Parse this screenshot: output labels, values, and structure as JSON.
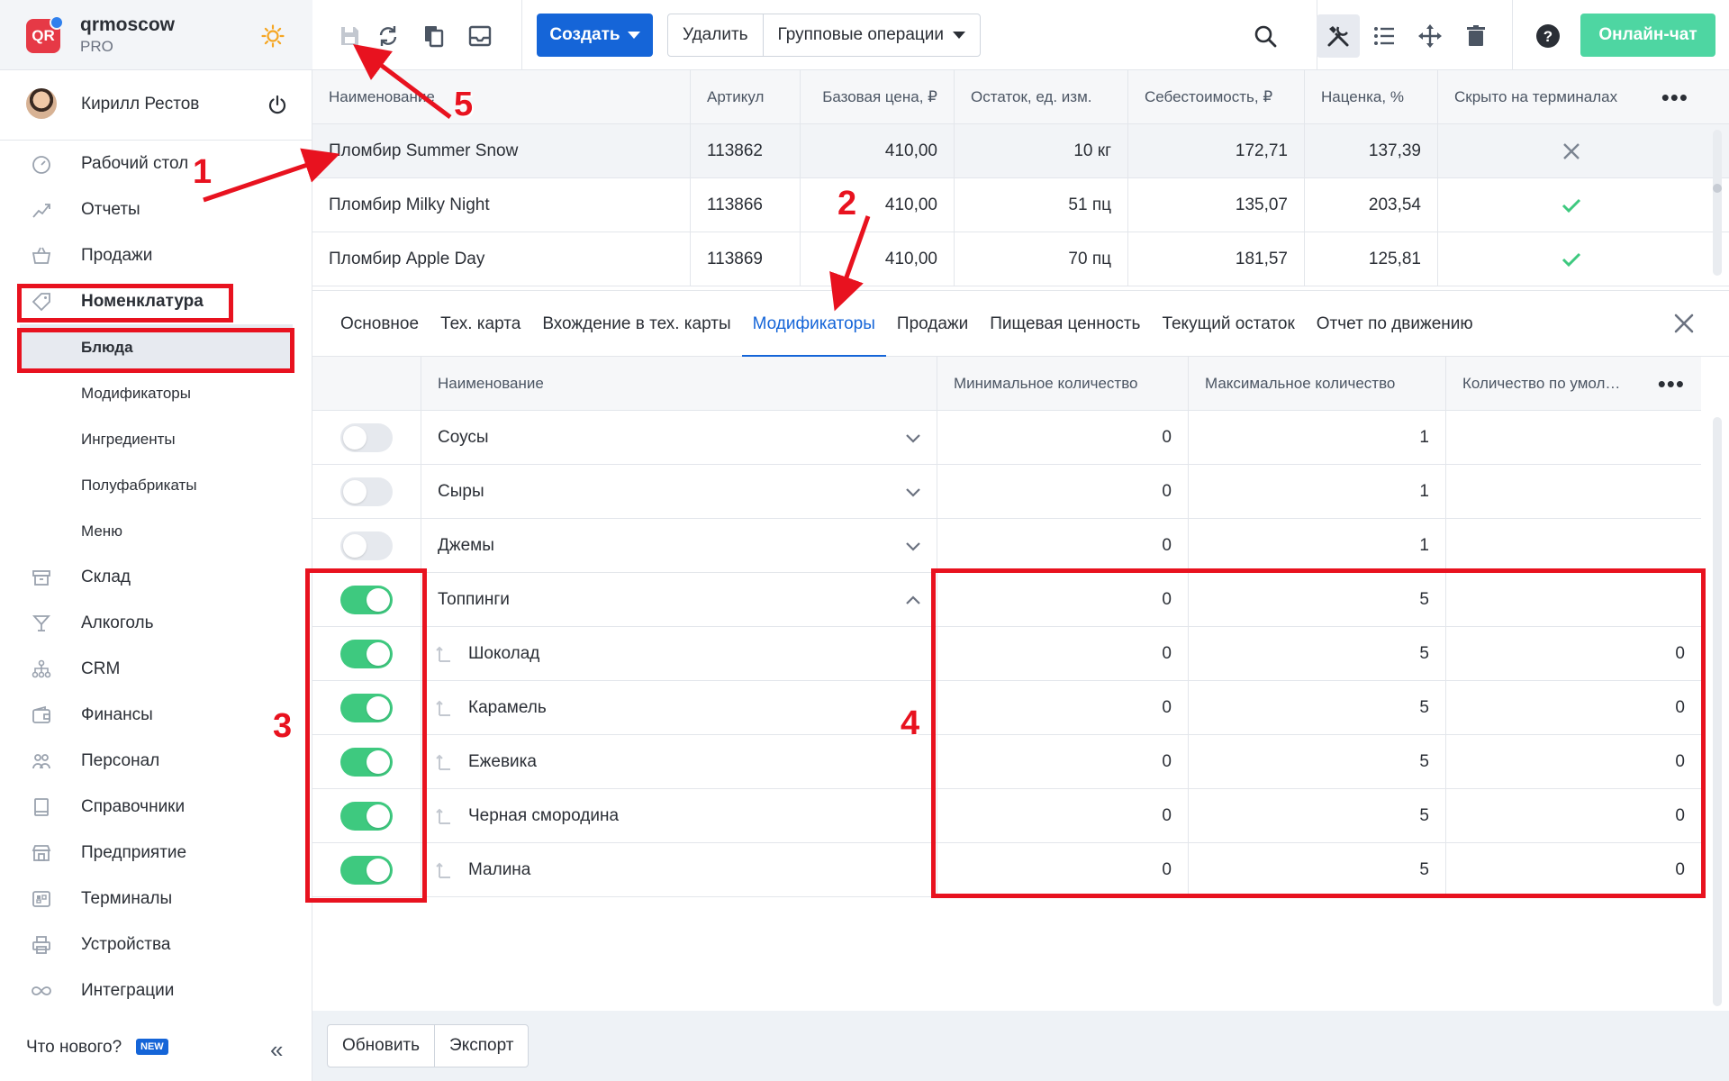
{
  "brand": {
    "name": "qrmoscow",
    "plan": "PRO",
    "logo_text": "QR"
  },
  "user": {
    "name": "Кирилл Рестов"
  },
  "nav": [
    {
      "label": "Рабочий стол",
      "icon": "dashboard-icon"
    },
    {
      "label": "Отчеты",
      "icon": "reports-icon"
    },
    {
      "label": "Продажи",
      "icon": "sales-basket-icon"
    },
    {
      "label": "Номенклатура",
      "icon": "tag-icon",
      "active": true
    },
    {
      "label": "Блюда",
      "sub": true,
      "active": true
    },
    {
      "label": "Модификаторы",
      "sub": true
    },
    {
      "label": "Ингредиенты",
      "sub": true
    },
    {
      "label": "Полуфабрикаты",
      "sub": true
    },
    {
      "label": "Меню",
      "sub": true
    },
    {
      "label": "Склад",
      "icon": "warehouse-icon"
    },
    {
      "label": "Алкоголь",
      "icon": "cocktail-icon"
    },
    {
      "label": "CRM",
      "icon": "crm-icon"
    },
    {
      "label": "Финансы",
      "icon": "wallet-icon"
    },
    {
      "label": "Персонал",
      "icon": "staff-icon"
    },
    {
      "label": "Справочники",
      "icon": "book-icon"
    },
    {
      "label": "Предприятие",
      "icon": "store-icon"
    },
    {
      "label": "Терминалы",
      "icon": "terminal-icon"
    },
    {
      "label": "Устройства",
      "icon": "printer-icon"
    },
    {
      "label": "Интеграции",
      "icon": "infinity-icon"
    }
  ],
  "sidebar_footer": {
    "whats_new": "Что нового?",
    "badge": "NEW"
  },
  "toolbar": {
    "create_label": "Создать",
    "delete_label": "Удалить",
    "group_ops_label": "Групповые операции",
    "chat_label": "Онлайн-чат"
  },
  "products": {
    "columns": [
      "Наименование",
      "Артикул",
      "Базовая цена, ₽",
      "Остаток, ед. изм.",
      "Себестоимость, ₽",
      "Наценка, %",
      "Скрыто на терминалах"
    ],
    "rows": [
      {
        "name": "Пломбир Summer Snow",
        "sku": "113862",
        "price": "410,00",
        "stock": "10 кг",
        "cost": "172,71",
        "markup": "137,39",
        "hidden": false
      },
      {
        "name": "Пломбир Milky Night",
        "sku": "113866",
        "price": "410,00",
        "stock": "51 пц",
        "cost": "135,07",
        "markup": "203,54",
        "hidden": true
      },
      {
        "name": "Пломбир Apple Day",
        "sku": "113869",
        "price": "410,00",
        "stock": "70 пц",
        "cost": "181,57",
        "markup": "125,81",
        "hidden": true
      }
    ]
  },
  "tabs": [
    "Основное",
    "Тех. карта",
    "Вхождение в тех. карты",
    "Модификаторы",
    "Продажи",
    "Пищевая ценность",
    "Текущий остаток",
    "Отчет по движению"
  ],
  "active_tab": "Модификаторы",
  "modifiers": {
    "columns": [
      "Наименование",
      "Минимальное количество",
      "Максимальное количество",
      "Количество по умол…"
    ],
    "rows": [
      {
        "name": "Соусы",
        "enabled": false,
        "min": "0",
        "max": "1",
        "def": "",
        "expand": "down"
      },
      {
        "name": "Сыры",
        "enabled": false,
        "min": "0",
        "max": "1",
        "def": "",
        "expand": "down"
      },
      {
        "name": "Джемы",
        "enabled": false,
        "min": "0",
        "max": "1",
        "def": "",
        "expand": "down"
      },
      {
        "name": "Топпинги",
        "enabled": true,
        "min": "0",
        "max": "5",
        "def": "",
        "expand": "up"
      },
      {
        "name": "Шоколад",
        "enabled": true,
        "min": "0",
        "max": "5",
        "def": "0",
        "child": true
      },
      {
        "name": "Карамель",
        "enabled": true,
        "min": "0",
        "max": "5",
        "def": "0",
        "child": true
      },
      {
        "name": "Ежевика",
        "enabled": true,
        "min": "0",
        "max": "5",
        "def": "0",
        "child": true
      },
      {
        "name": "Черная смородина",
        "enabled": true,
        "min": "0",
        "max": "5",
        "def": "0",
        "child": true
      },
      {
        "name": "Малина",
        "enabled": true,
        "min": "0",
        "max": "5",
        "def": "0",
        "child": true
      }
    ]
  },
  "footer": {
    "refresh_label": "Обновить",
    "export_label": "Экспорт"
  },
  "annotations": [
    "1",
    "2",
    "3",
    "4",
    "5"
  ],
  "colors": {
    "accent": "#1565d8",
    "success": "#3ec97f",
    "chat": "#4ed6a2",
    "annotation": "#e8121f",
    "logo": "#e63946"
  }
}
